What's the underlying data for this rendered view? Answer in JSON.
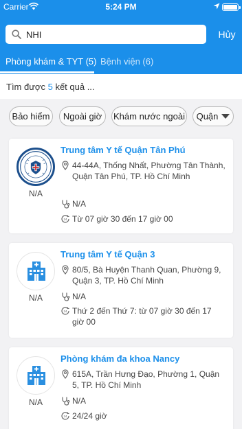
{
  "status_bar": {
    "carrier": "Carrier",
    "time": "5:24 PM"
  },
  "search": {
    "value": "NHI",
    "cancel_label": "Hủy"
  },
  "tabs": [
    {
      "label": "Phòng khám & TYT (5)",
      "active": true
    },
    {
      "label": "Bệnh viện (6)",
      "active": false
    }
  ],
  "results": {
    "prefix": "Tìm được",
    "count": "5",
    "suffix": "kết quả ..."
  },
  "filters": [
    {
      "label": "Bảo hiểm"
    },
    {
      "label": "Ngoài giờ"
    },
    {
      "label": "Khám nước ngoài"
    },
    {
      "label": "Quận"
    }
  ],
  "facilities": [
    {
      "name": "Trung tâm Y tế Quận Tân Phú",
      "address": "44-44A, Thống Nhất, Phường Tân Thành, Quận Tân Phú, TP. Hồ Chí Minh",
      "phone": "N/A",
      "hours": "Từ 07 giờ 30 đến 17 giờ 00",
      "rating": "N/A",
      "logo": "district-seal"
    },
    {
      "name": "Trung tâm Y tế Quận 3",
      "address": "80/5, Bà Huyện Thanh Quan, Phường 9, Quận 3, TP. Hồ Chí Minh",
      "phone": "N/A",
      "hours": "Thứ 2 đến Thứ 7: từ 07 giờ 30 đến 17 giờ 00",
      "rating": "N/A",
      "logo": "hospital-building-icon"
    },
    {
      "name": "Phòng khám đa khoa Nancy",
      "address": "615A, Trần Hưng Đạo, Phường 1, Quận 5, TP. Hồ Chí Minh",
      "phone": "N/A",
      "hours": "24/24 giờ",
      "rating": "N/A",
      "logo": "hospital-building-icon"
    }
  ],
  "colors": {
    "primary": "#1b8fea",
    "background": "#f2f2f4",
    "seal_blue": "#1c4f8c",
    "seal_red": "#d32f2f"
  }
}
